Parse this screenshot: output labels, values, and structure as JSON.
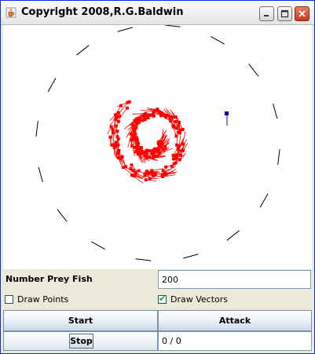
{
  "window": {
    "title": "Copyright 2008,R.G.Baldwin",
    "buttons": {
      "minimize": "minimize",
      "maximize": "maximize",
      "close": "close"
    }
  },
  "controls": {
    "prey_label": "Number Prey Fish",
    "prey_value": "200",
    "draw_points_label": "Draw Points",
    "draw_points_checked": false,
    "draw_vectors_label": "Draw Vectors",
    "draw_vectors_checked": true,
    "start_label": "Start",
    "attack_label": "Attack",
    "stop_label": "Stop",
    "status_text": "0 / 0"
  },
  "colors": {
    "prey": "#ff0000",
    "predator": "#0000cc",
    "boundary": "#000000"
  },
  "icons": {
    "app": "java-cup-icon",
    "minimize": "minimize-icon",
    "maximize": "maximize-icon",
    "close": "close-icon",
    "check": "check-icon"
  }
}
